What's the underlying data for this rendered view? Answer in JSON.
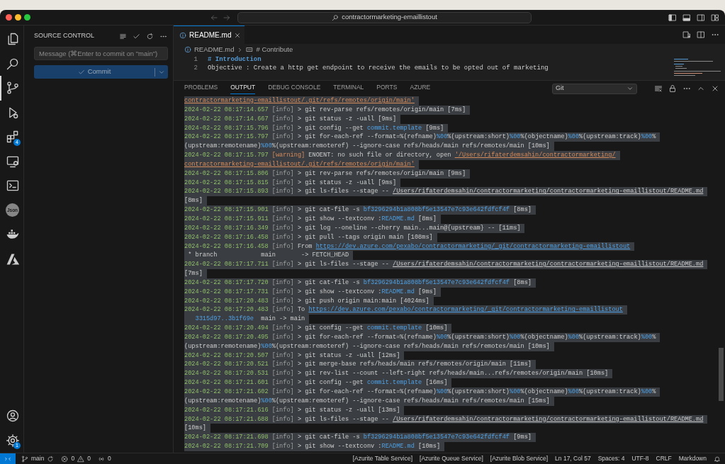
{
  "window": {
    "search": "contractormarketing-emaillistout"
  },
  "activity_bar": {
    "items": [
      {
        "selected": false
      },
      {
        "selected": false
      },
      {
        "selected": true
      },
      {
        "selected": false
      },
      {
        "selected": false,
        "badge": "4"
      },
      {
        "selected": false
      },
      {
        "selected": false
      },
      {
        "selected": false,
        "label": "Json"
      },
      {
        "selected": false
      },
      {
        "selected": false
      }
    ],
    "bottom": [
      {
        "selected": false
      },
      {
        "selected": false,
        "badge": "1"
      }
    ]
  },
  "sidebar": {
    "title": "SOURCE CONTROL",
    "placeholder": "Message (⌘Enter to commit on \"main\")",
    "commit": "Commit"
  },
  "editor": {
    "tabs": [
      {
        "label": "README.md",
        "selected": true
      }
    ],
    "breadcrumb": [
      "README.md",
      "# Contribute"
    ],
    "lines": [
      {
        "number": "1",
        "kind": "heading",
        "text": "# Introduction"
      },
      {
        "number": "2",
        "kind": "plain",
        "text": "Objective : Create a http get endpoint to receive the emails to be opted out of marketing"
      }
    ]
  },
  "panel": {
    "tabs": [
      {
        "label": "PROBLEMS",
        "selected": false
      },
      {
        "label": "OUTPUT",
        "selected": true
      },
      {
        "label": "DEBUG CONSOLE",
        "selected": false
      },
      {
        "label": "TERMINAL",
        "selected": false
      },
      {
        "label": "PORTS",
        "selected": false
      },
      {
        "label": "AZURE",
        "selected": false
      }
    ],
    "channel": "Git",
    "output": [
      {
        "segments": [
          {
            "kind": "warnpath",
            "text": "contractormarketing-emaillistout/.git/refs/remotes/origin/main'"
          }
        ]
      },
      {
        "segments": [
          {
            "kind": "time",
            "text": "2024-02-22 08:17:14.657 "
          },
          {
            "kind": "info",
            "text": "[info] "
          },
          {
            "kind": "text",
            "text": "> git rev-parse refs/remotes/origin/main [7ms]"
          }
        ]
      },
      {
        "segments": [
          {
            "kind": "time",
            "text": "2024-02-22 08:17:14.667 "
          },
          {
            "kind": "info",
            "text": "[info] "
          },
          {
            "kind": "text",
            "text": "> git status -z -uall [9ms]"
          }
        ]
      },
      {
        "segments": [
          {
            "kind": "time",
            "text": "2024-02-22 08:17:15.796 "
          },
          {
            "kind": "info",
            "text": "[info] "
          },
          {
            "kind": "text",
            "text": "> git config --get "
          },
          {
            "kind": "accent",
            "text": "commit.template"
          },
          {
            "kind": "text",
            "text": " [9ms]"
          }
        ]
      },
      {
        "segments": [
          {
            "kind": "time",
            "text": "2024-02-22 08:17:15.797 "
          },
          {
            "kind": "info",
            "text": "[info] "
          },
          {
            "kind": "text",
            "text": "> git for-each-ref --format=%(refname)"
          },
          {
            "kind": "accent",
            "text": "%00"
          },
          {
            "kind": "text",
            "text": "%(upstream:short)"
          },
          {
            "kind": "accent",
            "text": "%00"
          },
          {
            "kind": "text",
            "text": "%(objectname)"
          },
          {
            "kind": "accent",
            "text": "%00"
          },
          {
            "kind": "text",
            "text": "%(upstream:track)"
          },
          {
            "kind": "accent",
            "text": "%00"
          },
          {
            "kind": "text",
            "text": "%"
          }
        ]
      },
      {
        "segments": [
          {
            "kind": "text",
            "text": "(upstream:remotename)"
          },
          {
            "kind": "accent",
            "text": "%00"
          },
          {
            "kind": "text",
            "text": "%(upstream:remoteref) --ignore-case refs/heads/main refs/remotes/main [10ms]"
          }
        ]
      },
      {
        "segments": [
          {
            "kind": "time",
            "text": "2024-02-22 08:17:15.797 "
          },
          {
            "kind": "warning",
            "text": "[warning] "
          },
          {
            "kind": "text",
            "text": "ENOENT: no such file or directory, open "
          },
          {
            "kind": "warnpath",
            "text": "'/Users/rifaterdemsahin/contractormarketing/"
          }
        ]
      },
      {
        "segments": [
          {
            "kind": "warnpath",
            "text": "contractormarketing-emaillistout/.git/refs/remotes/origin/main'"
          }
        ]
      },
      {
        "segments": [
          {
            "kind": "time",
            "text": "2024-02-22 08:17:15.806 "
          },
          {
            "kind": "info",
            "text": "[info] "
          },
          {
            "kind": "text",
            "text": "> git rev-parse refs/remotes/origin/main [9ms]"
          }
        ]
      },
      {
        "segments": [
          {
            "kind": "time",
            "text": "2024-02-22 08:17:15.815 "
          },
          {
            "kind": "info",
            "text": "[info] "
          },
          {
            "kind": "text",
            "text": "> git status -z -uall [9ms]"
          }
        ]
      },
      {
        "segments": [
          {
            "kind": "time",
            "text": "2024-02-22 08:17:15.893 "
          },
          {
            "kind": "info",
            "text": "[info] "
          },
          {
            "kind": "text",
            "text": "> git ls-files --stage -- "
          },
          {
            "kind": "path",
            "text": "/Users/rifaterdemsahin/contractormarketing/contractormarketing-emaillistout/README.md"
          }
        ]
      },
      {
        "segments": [
          {
            "kind": "text",
            "text": "[8ms]"
          }
        ]
      },
      {
        "segments": [
          {
            "kind": "time",
            "text": "2024-02-22 08:17:15.901 "
          },
          {
            "kind": "info",
            "text": "[info] "
          },
          {
            "kind": "text",
            "text": "> git cat-file -s "
          },
          {
            "kind": "accent",
            "text": "bf3296294b1a808bf5e13547e7c93e642fdfcf4f"
          },
          {
            "kind": "text",
            "text": " [8ms]"
          }
        ]
      },
      {
        "segments": [
          {
            "kind": "time",
            "text": "2024-02-22 08:17:15.911 "
          },
          {
            "kind": "info",
            "text": "[info] "
          },
          {
            "kind": "text",
            "text": "> git show --textconv :"
          },
          {
            "kind": "accent",
            "text": "README.md"
          },
          {
            "kind": "text",
            "text": " [8ms]"
          }
        ]
      },
      {
        "segments": [
          {
            "kind": "time",
            "text": "2024-02-22 08:17:16.349 "
          },
          {
            "kind": "info",
            "text": "[info] "
          },
          {
            "kind": "text",
            "text": "> git log --oneline --cherry main...main@{upstream} -- [11ms]"
          }
        ]
      },
      {
        "segments": [
          {
            "kind": "time",
            "text": "2024-02-22 08:17:16.458 "
          },
          {
            "kind": "info",
            "text": "[info] "
          },
          {
            "kind": "text",
            "text": "> git pull --tags origin main [108ms]"
          }
        ]
      },
      {
        "segments": [
          {
            "kind": "time",
            "text": "2024-02-22 08:17:16.458 "
          },
          {
            "kind": "info",
            "text": "[info] "
          },
          {
            "kind": "text",
            "text": "From "
          },
          {
            "kind": "link",
            "text": "https://dev.azure.com/pexabo/contractormarketing/_git/contractormarketing-emaillistout"
          }
        ]
      },
      {
        "segments": [
          {
            "kind": "text",
            "text": " * branch            main       -> FETCH_HEAD"
          }
        ]
      },
      {
        "segments": [
          {
            "kind": "time",
            "text": "2024-02-22 08:17:17.711 "
          },
          {
            "kind": "info",
            "text": "[info] "
          },
          {
            "kind": "text",
            "text": "> git ls-files --stage -- "
          },
          {
            "kind": "path",
            "text": "/Users/rifaterdemsahin/contractormarketing/contractormarketing-emaillistout/README.md"
          }
        ]
      },
      {
        "segments": [
          {
            "kind": "text",
            "text": "[7ms]"
          }
        ]
      },
      {
        "segments": [
          {
            "kind": "time",
            "text": "2024-02-22 08:17:17.720 "
          },
          {
            "kind": "info",
            "text": "[info] "
          },
          {
            "kind": "text",
            "text": "> git cat-file -s "
          },
          {
            "kind": "accent",
            "text": "bf3296294b1a808bf5e13547e7c93e642fdfcf4f"
          },
          {
            "kind": "text",
            "text": " [8ms]"
          }
        ]
      },
      {
        "segments": [
          {
            "kind": "time",
            "text": "2024-02-22 08:17:17.731 "
          },
          {
            "kind": "info",
            "text": "[info] "
          },
          {
            "kind": "text",
            "text": "> git show --textconv :"
          },
          {
            "kind": "accent",
            "text": "README.md"
          },
          {
            "kind": "text",
            "text": " [9ms]"
          }
        ]
      },
      {
        "segments": [
          {
            "kind": "time",
            "text": "2024-02-22 08:17:20.483 "
          },
          {
            "kind": "info",
            "text": "[info] "
          },
          {
            "kind": "text",
            "text": "> git push origin main:main [4024ms]"
          }
        ]
      },
      {
        "segments": [
          {
            "kind": "time",
            "text": "2024-02-22 08:17:20.483 "
          },
          {
            "kind": "info",
            "text": "[info] "
          },
          {
            "kind": "text",
            "text": "To "
          },
          {
            "kind": "link",
            "text": "https://dev.azure.com/pexabo/contractormarketing/_git/contractormarketing-emaillistout"
          }
        ]
      },
      {
        "segments": [
          {
            "kind": "accent",
            "text": "   3315d97..3b1f69e"
          },
          {
            "kind": "text",
            "text": "  main -> main"
          }
        ]
      },
      {
        "segments": [
          {
            "kind": "time",
            "text": "2024-02-22 08:17:20.494 "
          },
          {
            "kind": "info",
            "text": "[info] "
          },
          {
            "kind": "text",
            "text": "> git config --get "
          },
          {
            "kind": "accent",
            "text": "commit.template"
          },
          {
            "kind": "text",
            "text": " [10ms]"
          }
        ]
      },
      {
        "segments": [
          {
            "kind": "time",
            "text": "2024-02-22 08:17:20.495 "
          },
          {
            "kind": "info",
            "text": "[info] "
          },
          {
            "kind": "text",
            "text": "> git for-each-ref --format=%(refname)"
          },
          {
            "kind": "accent",
            "text": "%00"
          },
          {
            "kind": "text",
            "text": "%(upstream:short)"
          },
          {
            "kind": "accent",
            "text": "%00"
          },
          {
            "kind": "text",
            "text": "%(objectname)"
          },
          {
            "kind": "accent",
            "text": "%00"
          },
          {
            "kind": "text",
            "text": "%(upstream:track)"
          },
          {
            "kind": "accent",
            "text": "%00"
          },
          {
            "kind": "text",
            "text": "%"
          }
        ]
      },
      {
        "segments": [
          {
            "kind": "text",
            "text": "(upstream:remotename)"
          },
          {
            "kind": "accent",
            "text": "%00"
          },
          {
            "kind": "text",
            "text": "%(upstream:remoteref) --ignore-case refs/heads/main refs/remotes/main [10ms]"
          }
        ]
      },
      {
        "segments": [
          {
            "kind": "time",
            "text": "2024-02-22 08:17:20.507 "
          },
          {
            "kind": "info",
            "text": "[info] "
          },
          {
            "kind": "text",
            "text": "> git status -z -uall [12ms]"
          }
        ]
      },
      {
        "segments": [
          {
            "kind": "time",
            "text": "2024-02-22 08:17:20.521 "
          },
          {
            "kind": "info",
            "text": "[info] "
          },
          {
            "kind": "text",
            "text": "> git merge-base refs/heads/main refs/remotes/origin/main [11ms]"
          }
        ]
      },
      {
        "segments": [
          {
            "kind": "time",
            "text": "2024-02-22 08:17:20.531 "
          },
          {
            "kind": "info",
            "text": "[info] "
          },
          {
            "kind": "text",
            "text": "> git rev-list --count --left-right refs/heads/main...refs/remotes/origin/main [10ms]"
          }
        ]
      },
      {
        "segments": [
          {
            "kind": "time",
            "text": "2024-02-22 08:17:21.601 "
          },
          {
            "kind": "info",
            "text": "[info] "
          },
          {
            "kind": "text",
            "text": "> git config --get "
          },
          {
            "kind": "accent",
            "text": "commit.template"
          },
          {
            "kind": "text",
            "text": " [16ms]"
          }
        ]
      },
      {
        "segments": [
          {
            "kind": "time",
            "text": "2024-02-22 08:17:21.602 "
          },
          {
            "kind": "info",
            "text": "[info] "
          },
          {
            "kind": "text",
            "text": "> git for-each-ref --format=%(refname)"
          },
          {
            "kind": "accent",
            "text": "%00"
          },
          {
            "kind": "text",
            "text": "%(upstream:short)"
          },
          {
            "kind": "accent",
            "text": "%00"
          },
          {
            "kind": "text",
            "text": "%(objectname)"
          },
          {
            "kind": "accent",
            "text": "%00"
          },
          {
            "kind": "text",
            "text": "%(upstream:track)"
          },
          {
            "kind": "accent",
            "text": "%00"
          },
          {
            "kind": "text",
            "text": "%"
          }
        ]
      },
      {
        "segments": [
          {
            "kind": "text",
            "text": "(upstream:remotename)"
          },
          {
            "kind": "accent",
            "text": "%00"
          },
          {
            "kind": "text",
            "text": "%(upstream:remoteref) --ignore-case refs/heads/main refs/remotes/main [15ms]"
          }
        ]
      },
      {
        "segments": [
          {
            "kind": "time",
            "text": "2024-02-22 08:17:21.616 "
          },
          {
            "kind": "info",
            "text": "[info] "
          },
          {
            "kind": "text",
            "text": "> git status -z -uall [13ms]"
          }
        ]
      },
      {
        "segments": [
          {
            "kind": "time",
            "text": "2024-02-22 08:17:21.688 "
          },
          {
            "kind": "info",
            "text": "[info] "
          },
          {
            "kind": "text",
            "text": "> git ls-files --stage -- "
          },
          {
            "kind": "path",
            "text": "/Users/rifaterdemsahin/contractormarketing/contractormarketing-emaillistout/README.md"
          }
        ]
      },
      {
        "segments": [
          {
            "kind": "text",
            "text": "[10ms]"
          }
        ]
      },
      {
        "segments": [
          {
            "kind": "time",
            "text": "2024-02-22 08:17:21.698 "
          },
          {
            "kind": "info",
            "text": "[info] "
          },
          {
            "kind": "text",
            "text": "> git cat-file -s "
          },
          {
            "kind": "accent",
            "text": "bf3296294b1a808bf5e13547e7c93e642fdfcf4f"
          },
          {
            "kind": "text",
            "text": " [9ms]"
          }
        ]
      },
      {
        "segments": [
          {
            "kind": "time",
            "text": "2024-02-22 08:17:21.709 "
          },
          {
            "kind": "info",
            "text": "[info] "
          },
          {
            "kind": "text",
            "text": "> git show --textconv :"
          },
          {
            "kind": "accent",
            "text": "README.md"
          },
          {
            "kind": "text",
            "text": " [10ms]"
          }
        ]
      }
    ]
  },
  "status_bar": {
    "branch": "main",
    "errors": "0",
    "warnings": "0",
    "ports": "0",
    "items": [
      "[Azurite Table Service]",
      "[Azurite Queue Service]",
      "[Azurite Blob Service]",
      "Ln 17, Col 57",
      "Spaces: 4",
      "UTF-8",
      "CRLF",
      "Markdown"
    ]
  }
}
